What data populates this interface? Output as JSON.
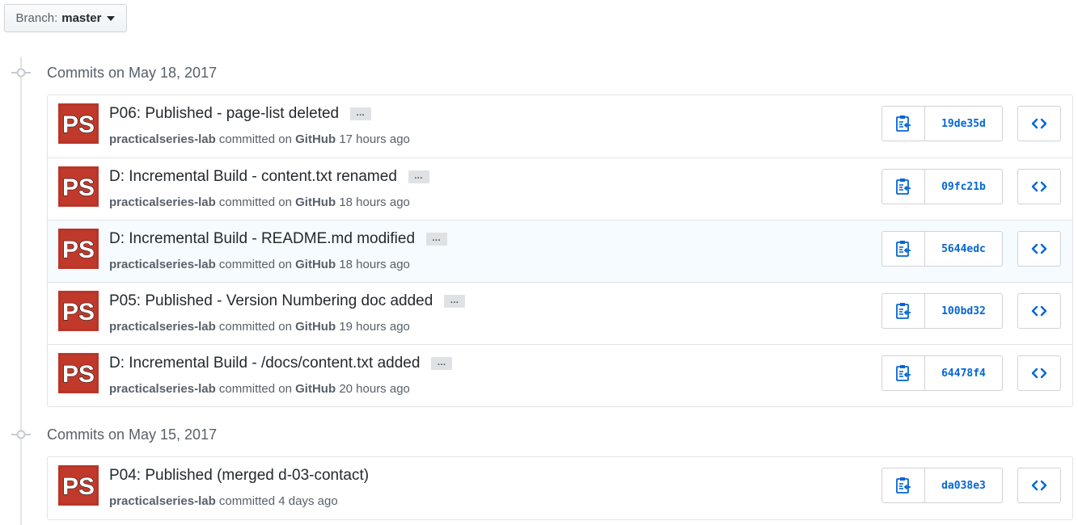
{
  "branch": {
    "label": "Branch:",
    "value": "master"
  },
  "groups": [
    {
      "title": "Commits on May 18, 2017",
      "commits": [
        {
          "message": "P06: Published - page-list deleted",
          "author": "practicalseries-lab",
          "committed_text": "committed on",
          "platform": "GitHub",
          "time": "17 hours ago",
          "sha": "19de35d"
        },
        {
          "message": "D: Incremental Build - content.txt renamed",
          "author": "practicalseries-lab",
          "committed_text": "committed on",
          "platform": "GitHub",
          "time": "18 hours ago",
          "sha": "09fc21b"
        },
        {
          "message": "D: Incremental Build - README.md modified",
          "author": "practicalseries-lab",
          "committed_text": "committed on",
          "platform": "GitHub",
          "time": "18 hours ago",
          "sha": "5644edc"
        },
        {
          "message": "P05: Published - Version Numbering doc added",
          "author": "practicalseries-lab",
          "committed_text": "committed on",
          "platform": "GitHub",
          "time": "19 hours ago",
          "sha": "100bd32"
        },
        {
          "message": "D: Incremental Build - /docs/content.txt added",
          "author": "practicalseries-lab",
          "committed_text": "committed on",
          "platform": "GitHub",
          "time": "20 hours ago",
          "sha": "64478f4"
        }
      ]
    },
    {
      "title": "Commits on May 15, 2017",
      "commits": [
        {
          "message": "P04: Published (merged d-03-contact)",
          "author": "practicalseries-lab",
          "committed_text": "committed",
          "platform": "",
          "time": "4 days ago",
          "sha": "da038e3"
        }
      ]
    }
  ],
  "ellipsis_label": "…",
  "avatar_text": "PS",
  "colors": {
    "avatar_bg": "#c0392b",
    "link": "#0366d6",
    "muted": "#586069"
  },
  "icons": {
    "copy": "clippy-icon",
    "browse": "code-icon",
    "commit": "git-commit-icon",
    "caret": "caret-down-icon"
  }
}
